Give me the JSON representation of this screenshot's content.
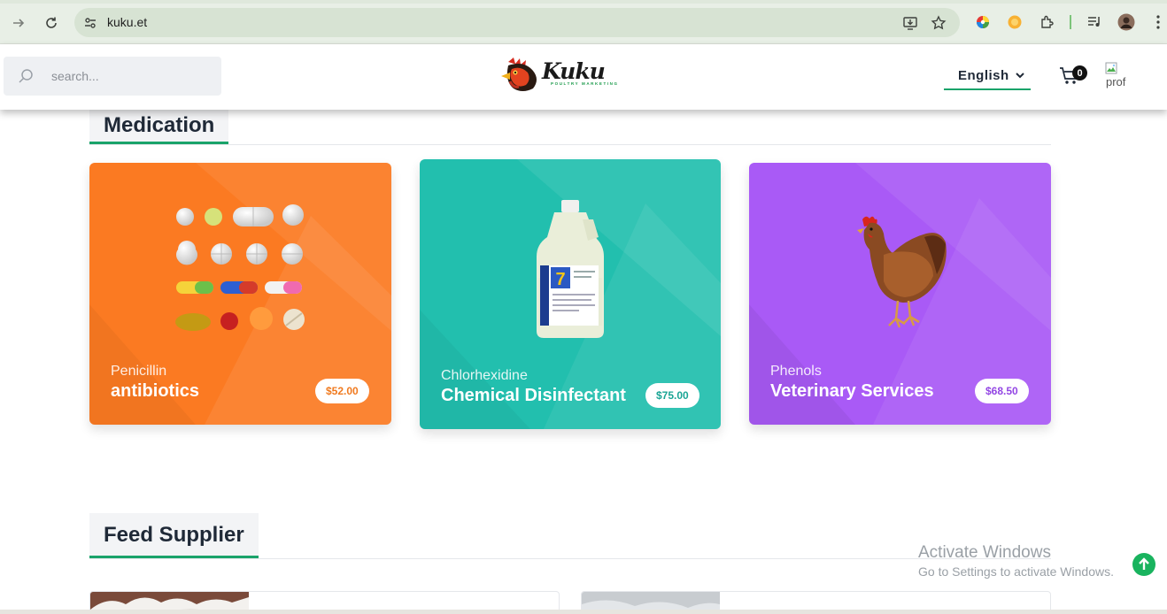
{
  "browser": {
    "url": "kuku.et"
  },
  "header": {
    "search_placeholder": "search...",
    "language": "English",
    "cart_count": "0",
    "profile_alt": "prof"
  },
  "sections": {
    "medication": {
      "title": "Medication",
      "cards": [
        {
          "category": "Penicillin",
          "name": "antibiotics",
          "price": "$52.00",
          "color": "#fb7a22",
          "price_color": "#f07a1f"
        },
        {
          "category": "Chlorhexidine",
          "name": "Chemical Disinfectant",
          "price": "$75.00",
          "color": "#22bfae",
          "price_color": "#1aa595"
        },
        {
          "category": "Phenols",
          "name": "Veterinary Services",
          "price": "$68.50",
          "color": "#a95af6",
          "price_color": "#9346e4"
        }
      ]
    },
    "feed": {
      "title": "Feed Supplier"
    }
  },
  "watermark": {
    "line1": "Activate Windows",
    "line2": "Go to Settings to activate Windows."
  },
  "colors": {
    "accent": "#1aa36a",
    "scroll_top": "#19b35e"
  },
  "icons": {
    "back": "arrow-right-icon",
    "reload": "reload-icon",
    "site_info": "tune-icon",
    "install": "install-icon",
    "bookmark": "star-icon",
    "search": "search-icon",
    "cart": "cart-icon",
    "scroll_top": "arrow-up-icon"
  }
}
